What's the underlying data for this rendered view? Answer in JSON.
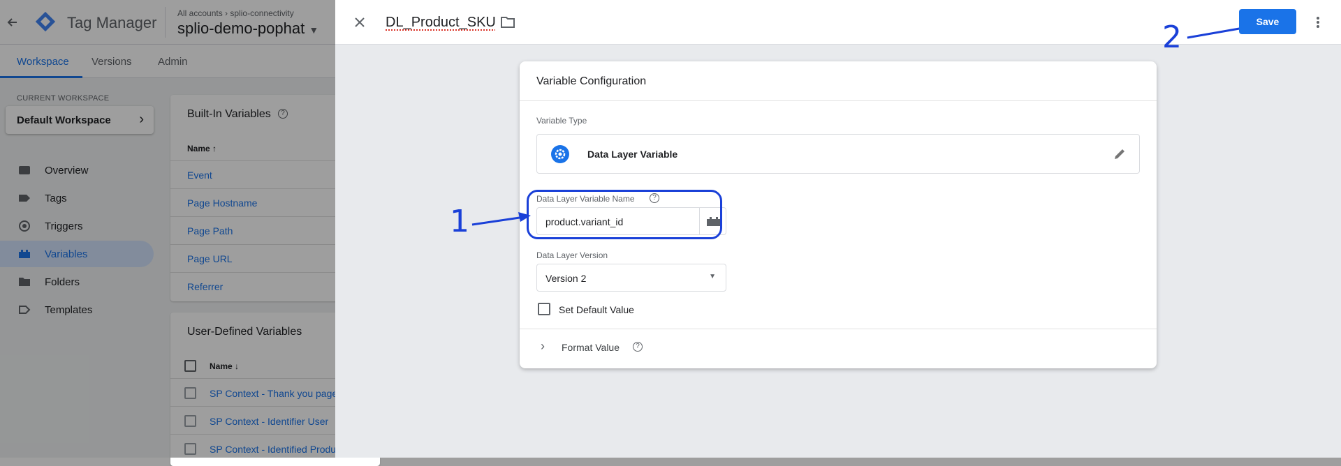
{
  "header": {
    "app_name": "Tag Manager",
    "breadcrumb_all": "All accounts",
    "breadcrumb_container": "splio-connectivity",
    "container_name": "splio-demo-pophat"
  },
  "tabs": [
    {
      "label": "Workspace"
    },
    {
      "label": "Versions"
    },
    {
      "label": "Admin"
    }
  ],
  "workspace": {
    "current_label": "CURRENT WORKSPACE",
    "name": "Default Workspace"
  },
  "sidebar": {
    "items": [
      {
        "label": "Overview",
        "icon": "overview-icon"
      },
      {
        "label": "Tags",
        "icon": "tag-icon"
      },
      {
        "label": "Triggers",
        "icon": "trigger-icon"
      },
      {
        "label": "Variables",
        "icon": "variables-icon",
        "active": true
      },
      {
        "label": "Folders",
        "icon": "folder-icon"
      },
      {
        "label": "Templates",
        "icon": "template-icon"
      }
    ]
  },
  "builtin": {
    "title": "Built-In Variables",
    "column_name": "Name",
    "rows": [
      "Event",
      "Page Hostname",
      "Page Path",
      "Page URL",
      "Referrer"
    ]
  },
  "user_defined": {
    "title": "User-Defined Variables",
    "column_name": "Name",
    "rows": [
      "SP Context - Thank you page",
      "SP Context - Identifier User",
      "SP Context - Identified Produ"
    ]
  },
  "panel": {
    "variable_name": "DL_Product_SKU",
    "save_label": "Save"
  },
  "config": {
    "title": "Variable Configuration",
    "type_label": "Variable Type",
    "type_value": "Data Layer Variable",
    "name_label": "Data Layer Variable Name",
    "name_value": "product.variant_id",
    "version_label": "Data Layer Version",
    "version_value": "Version 2",
    "default_label": "Set Default Value",
    "format_label": "Format Value"
  },
  "annotations": {
    "one": "1",
    "two": "2"
  },
  "colors": {
    "accent": "#1a73e8",
    "annotation": "#1a40d8"
  }
}
